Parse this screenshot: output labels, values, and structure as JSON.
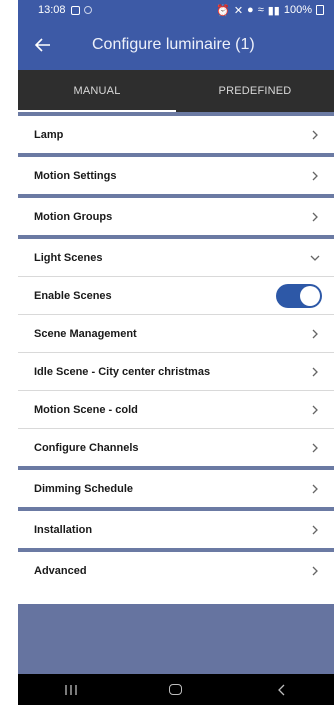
{
  "status_bar": {
    "time": "13:08",
    "battery": "100%"
  },
  "app_bar": {
    "title": "Configure luminaire (1)"
  },
  "tabs": [
    {
      "label": "MANUAL",
      "active": true
    },
    {
      "label": "PREDEFINED",
      "active": false
    }
  ],
  "list": {
    "lamp": "Lamp",
    "motion_settings": "Motion Settings",
    "motion_groups": "Motion Groups",
    "light_scenes": "Light Scenes",
    "enable_scenes": "Enable Scenes",
    "enable_scenes_on": true,
    "scene_management": "Scene Management",
    "idle_scene": "Idle Scene - City center christmas",
    "motion_scene": "Motion Scene - cold",
    "configure_channels": "Configure Channels",
    "dimming_schedule": "Dimming Schedule",
    "installation": "Installation",
    "advanced": "Advanced"
  },
  "colors": {
    "header": "#3d5aa6",
    "tabs_bg": "#2e2e2e",
    "section_divider": "#6b7aa3",
    "toggle_on": "#2d58a7",
    "footer": "#6674a0"
  }
}
